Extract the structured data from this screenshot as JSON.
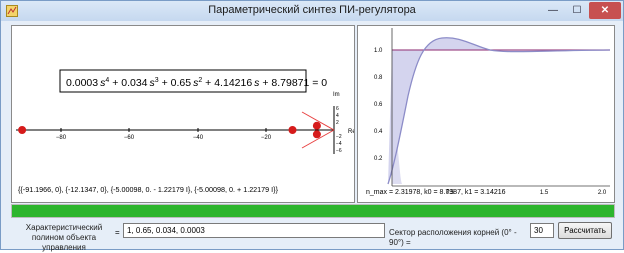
{
  "window": {
    "title": "Параметрический синтез ПИ-регулятора",
    "buttons": {
      "minimize": "—",
      "maximize": "☐",
      "close": "✕"
    }
  },
  "root_plot": {
    "polynomial_parts": [
      "0.0003",
      "s",
      "4",
      " + 0.034",
      "s",
      "3",
      " + 0.65",
      "s",
      "2",
      " + 4.14216",
      "s",
      " + 8.79871 = 0"
    ],
    "x_ticks": [
      "−80",
      "−60",
      "−40",
      "−20"
    ],
    "y_ticks": [
      "6",
      "4",
      "2",
      "−2",
      "−4",
      "−6"
    ],
    "axis_labels": {
      "im": "Im",
      "re": "Re"
    },
    "roots_text": "{{-91.1966, 0}, {-12.1347, 0}, {-5.00098, 0. - 1.22179 I}, {-5.00098, 0. + 1.22179 I}}",
    "roots": [
      {
        "re": -91.1966,
        "im": 0
      },
      {
        "re": -12.1347,
        "im": 0
      },
      {
        "re": -5.00098,
        "im": -1.22179
      },
      {
        "re": -5.00098,
        "im": 1.22179
      }
    ],
    "sector_angle_deg": 30,
    "colors": {
      "root": "#d61b1b",
      "sector": "#e84040",
      "axis": "#000000"
    }
  },
  "step_plot": {
    "y_ticks": [
      "1.0",
      "0.8",
      "0.6",
      "0.4",
      "0.2"
    ],
    "x_ticks": [
      "0.5",
      "1.5",
      "2.0"
    ],
    "params_text": "n_max = 2.31978, k0 = 8.7987, k1 = 3.14216",
    "colors": {
      "curve": "#8c8cc8",
      "fill": "#d4d4ee",
      "reference": "#a0508c"
    }
  },
  "progress": {
    "value_percent": 100,
    "color": "#2db52d"
  },
  "form": {
    "poly_label": "Характеристический полином объекта управления",
    "equals": "=",
    "poly_value": "1, 0.65, 0.034, 0.0003",
    "sector_label": "Сектор расположения корней (0° - 90°) =",
    "sector_value": "30",
    "calc_label": "Рассчитать"
  }
}
